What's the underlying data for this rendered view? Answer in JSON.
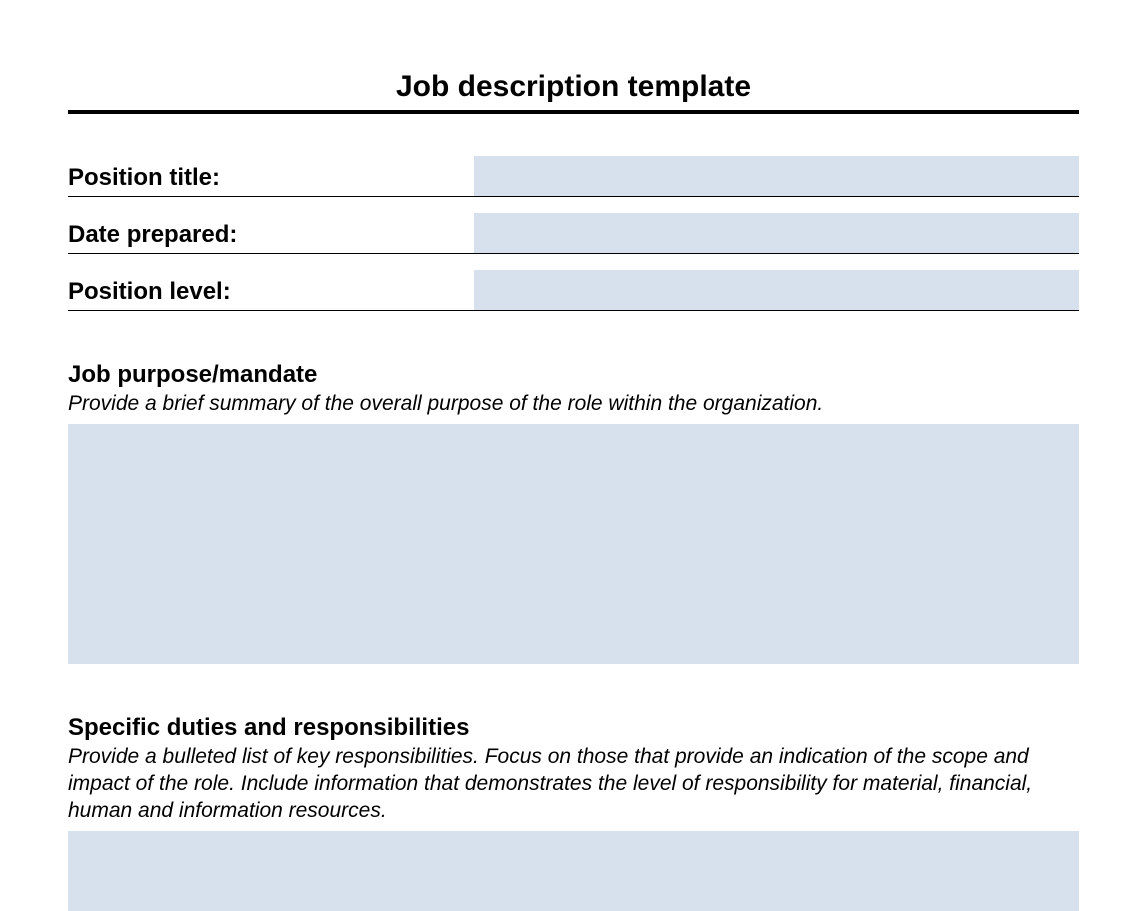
{
  "title": "Job description template",
  "fields": {
    "position_title": {
      "label": "Position title:",
      "value": ""
    },
    "date_prepared": {
      "label": "Date prepared:",
      "value": ""
    },
    "position_level": {
      "label": "Position level:",
      "value": ""
    }
  },
  "sections": {
    "purpose": {
      "heading": "Job purpose/mandate",
      "hint": "Provide a brief summary of the overall purpose of the role within the organization.",
      "value": ""
    },
    "duties": {
      "heading": "Specific duties and responsibilities",
      "hint": "Provide a bulleted list of key responsibilities. Focus on those that provide an indication of the scope and impact of the role. Include information that demonstrates the level of responsibility for material, financial, human and information resources.",
      "value": ""
    }
  },
  "colors": {
    "input_bg": "#d7e1ee"
  }
}
